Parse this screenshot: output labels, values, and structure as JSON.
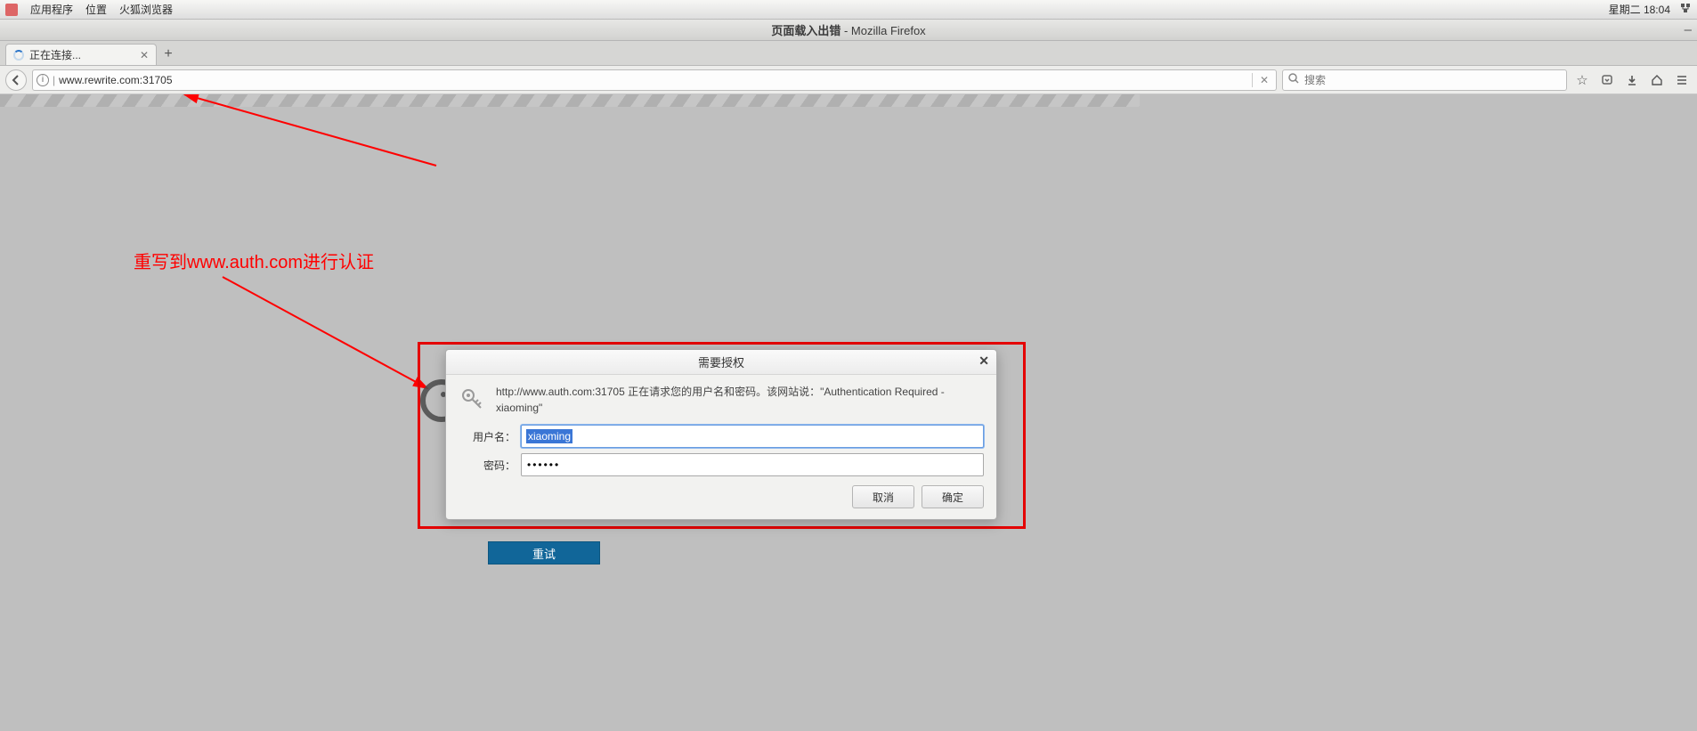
{
  "panel": {
    "apps": "应用程序",
    "places": "位置",
    "browser": "火狐浏览器",
    "clock": "星期二 18:04"
  },
  "window": {
    "title_plain": "页面载入出错",
    "title_suffix": " - Mozilla Firefox"
  },
  "tab": {
    "label": "正在连接..."
  },
  "url": {
    "value": "www.rewrite.com:31705"
  },
  "search": {
    "placeholder": "搜索"
  },
  "annotation": {
    "text": "重写到www.auth.com进行认证"
  },
  "dialog": {
    "title": "需要授权",
    "message": "http://www.auth.com:31705 正在请求您的用户名和密码。该网站说：\"Authentication Required - xiaoming\"",
    "username_label": "用户名：",
    "password_label": "密码：",
    "username_value": "xiaoming",
    "password_value": "••••••",
    "cancel": "取消",
    "ok": "确定"
  },
  "retry": "重试"
}
